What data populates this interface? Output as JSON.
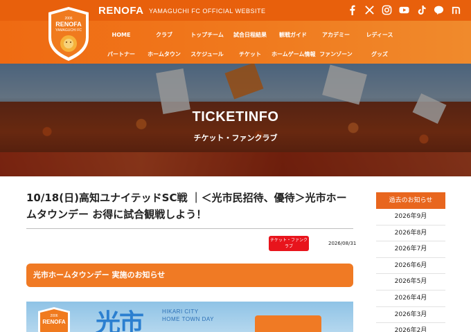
{
  "header": {
    "brand": "RENOFA",
    "brand_sub": "YAMAGUCHI FC  OFFICIAL WEBSITE",
    "logo": {
      "year": "2006",
      "name": "RENOFA",
      "sub": "YAMAGUCHI FC"
    },
    "social_icons": [
      "facebook-icon",
      "x-icon",
      "instagram-icon",
      "youtube-icon",
      "tiktok-icon",
      "line-icon",
      "note-icon"
    ],
    "nav_row1": [
      "HOME",
      "クラブ",
      "トップチーム",
      "試合日程結果",
      "観戦ガイド",
      "アカデミー",
      "レディース"
    ],
    "nav_row2": [
      "パートナー",
      "ホームタウン",
      "スケジュール",
      "チケット",
      "ホームゲーム情報",
      "ファンゾーン",
      "グッズ"
    ]
  },
  "hero": {
    "title": "TICKETINFO",
    "subtitle": "チケット・ファンクラブ"
  },
  "article": {
    "title": "10/18(日)高知ユナイテッドSC戦 ｜＜光市民招待、優待＞光市ホームタウンデー お得に試合観戦しよう！",
    "badge": "チケット・ファンクラブ",
    "date": "2026/08/31",
    "section_heading": "光市ホームタウンデー 実施のお知らせ",
    "poster": {
      "logo_year": "2006",
      "logo_name": "RENOFA",
      "big_text": "光市",
      "en_line1": "HIKARI CITY",
      "en_line2": "HOME TOWN DAY"
    }
  },
  "sidebar": {
    "heading": "過去のお知らせ",
    "items": [
      "2026年9月",
      "2026年8月",
      "2026年7月",
      "2026年6月",
      "2026年5月",
      "2026年4月",
      "2026年3月",
      "2026年2月"
    ]
  },
  "colors": {
    "brand_orange": "#f07a1e",
    "badge_red": "#e8141c",
    "poster_blue": "#2b7fd0"
  }
}
